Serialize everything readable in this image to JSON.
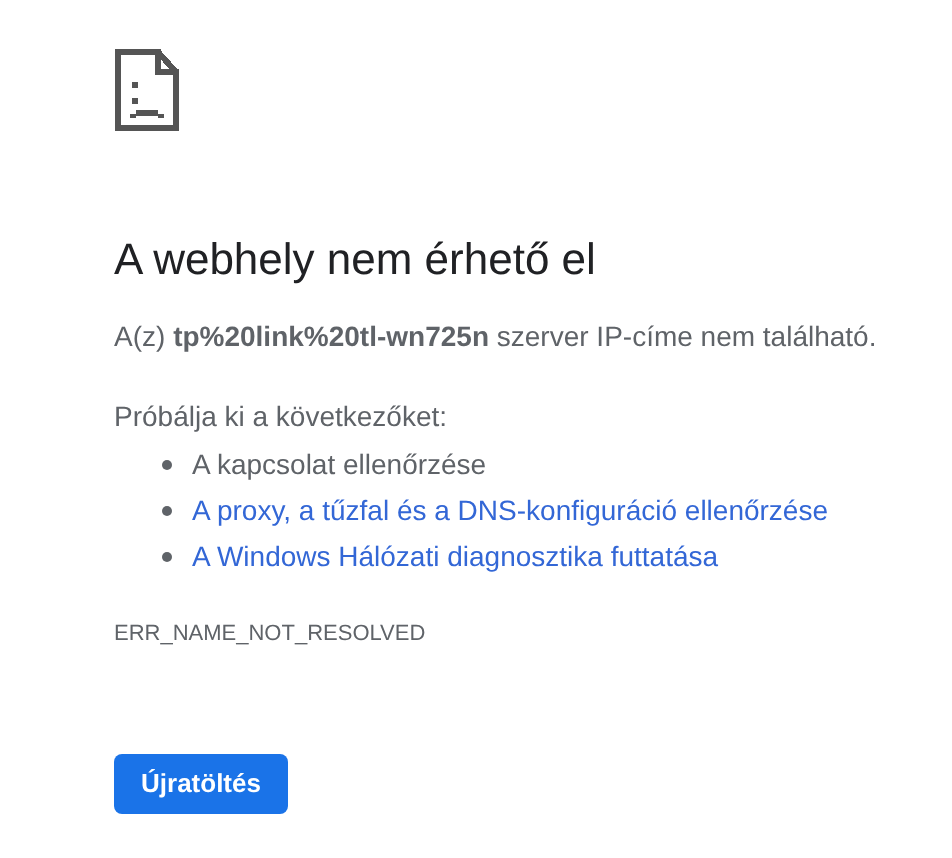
{
  "heading": "A webhely nem érhető el",
  "message": "A(z) **tp%20link%20tl-wn725n** szerver IP-címe nem található.",
  "suggestions_intro": "Próbálja ki a következőket:",
  "suggestions": [
    {
      "kind": "text",
      "text": "A kapcsolat ellenőrzése"
    },
    {
      "kind": "link",
      "text": "A proxy, a tűzfal és a DNS-konfiguráció ellenőrzése"
    },
    {
      "kind": "link",
      "text": "A Windows Hálózati diagnosztika futtatása"
    }
  ],
  "error_code": "ERR_NAME_NOT_RESOLVED",
  "reload_button": "Újratöltés"
}
